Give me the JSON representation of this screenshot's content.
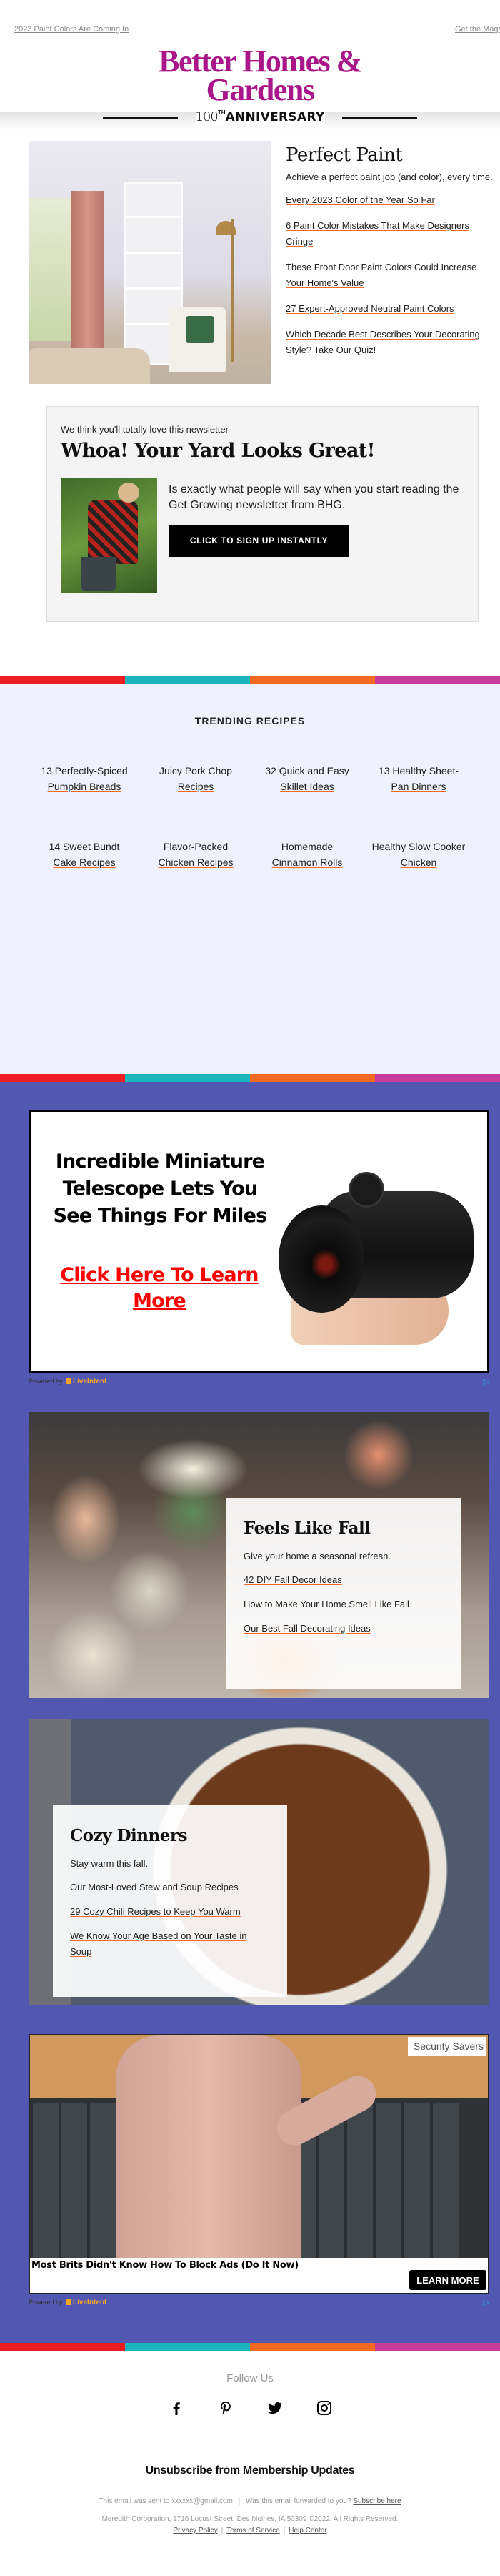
{
  "colors": {
    "brand": "#a8168a",
    "link_underline": "#f26a21",
    "stripe": [
      "#ed1c24",
      "#1ab4bb",
      "#f26a21",
      "#c63b9c"
    ],
    "trending_bg": "#eff1fd",
    "purple_bg": "#5258b2"
  },
  "preheader": {
    "left_link": "2023 Paint Colors Are Coming In",
    "right_link": "Get the Magazine"
  },
  "logo": {
    "name": "Better Homes & Gardens",
    "anniversary_number": "100",
    "anniversary_suffix": "TH",
    "anniversary_word": "ANNIVERSARY"
  },
  "paint": {
    "title": "Perfect Paint",
    "subtitle": "Achieve a perfect paint job (and color), every time.",
    "links": [
      "Every 2023 Color of the Year So Far",
      "6 Paint Color Mistakes That Make Designers Cringe",
      "These Front Door Paint Colors Could Increase Your Home's Value",
      "27 Expert-Approved Neutral Paint Colors",
      "Which Decade Best Describes Your Decorating Style? Take Our Quiz!"
    ]
  },
  "newsletter": {
    "kicker": "We think you'll totally love this newsletter",
    "title": "Whoa! Your Yard Looks Great!",
    "description": "Is exactly what people will say when you start reading the Get Growing newsletter from BHG.",
    "button": "CLICK TO SIGN UP INSTANTLY"
  },
  "trending": {
    "title": "TRENDING RECIPES",
    "recipes": [
      {
        "label": "13 Perfectly-Spiced Pumpkin Breads"
      },
      {
        "label": "Juicy Pork Chop Recipes"
      },
      {
        "label": "32 Quick and Easy Skillet Ideas"
      },
      {
        "label": "13 Healthy Sheet-Pan Dinners"
      },
      {
        "label": "14 Sweet Bundt Cake Recipes"
      },
      {
        "label": "Flavor-Packed Chicken Recipes"
      },
      {
        "label": "Homemade Cinnamon Rolls"
      },
      {
        "label": "Healthy Slow Cooker Chicken"
      }
    ]
  },
  "ad1": {
    "headline": "Incredible Miniature Telescope Lets You See Things For Miles",
    "cta": "Click Here To Learn More",
    "powered_by": "Powered by",
    "provider": "LiveIntent",
    "adchoices_icon": "ad-choices-icon"
  },
  "fall": {
    "title": "Feels Like Fall",
    "subtitle": "Give your home a seasonal refresh.",
    "links": [
      "42 DIY Fall Decor Ideas",
      "How to Make Your Home Smell Like Fall",
      "Our Best Fall Decorating Ideas"
    ]
  },
  "cozy": {
    "title": "Cozy Dinners",
    "subtitle": "Stay warm this fall.",
    "links": [
      "Our Most-Loved Stew and Soup Recipes",
      "29 Cozy Chili Recipes to Keep You Warm",
      "We Know Your Age Based on Your Taste in Soup"
    ]
  },
  "ad2": {
    "badge": "Security Savers",
    "headline": "Most Brits Didn't Know How To Block Ads (Do It Now)",
    "button": "LEARN MORE",
    "powered_by": "Powered by",
    "provider": "LiveIntent"
  },
  "footer": {
    "follow": "Follow Us",
    "social": [
      "facebook-icon",
      "pinterest-icon",
      "twitter-icon",
      "instagram-icon"
    ],
    "unsubscribe": "Unsubscribe from Membership Updates",
    "sent_prefix": "This email was sent to",
    "email": "xxxxxx@gmail.com",
    "forwarded": "Was this email forwarded to you?",
    "subscribe_link": "Subscribe here",
    "address": "Meredith Corporation, 1716 Locust Street, Des Moines, IA 50309 ©2022. All Rights Reserved.",
    "legal_links": [
      "Privacy Policy",
      "Terms of Service",
      "Help Center"
    ]
  }
}
